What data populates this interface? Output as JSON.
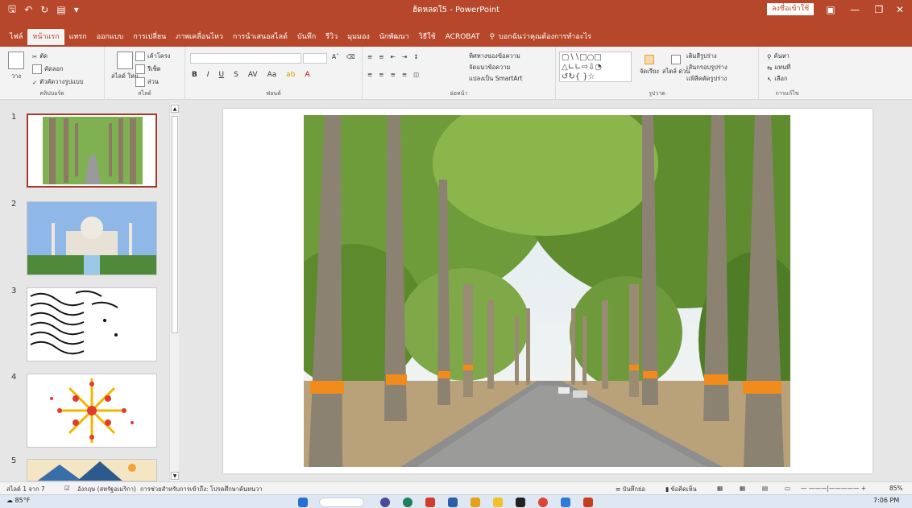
{
  "window": {
    "title": "ฮ้ดหลดใ5 - PowerPoint",
    "signin": "ลงชื่อเข้าใช้",
    "qat": [
      "save-icon",
      "undo-icon",
      "redo-icon",
      "present-icon",
      "customize-icon"
    ]
  },
  "tabs": [
    {
      "label": "ไฟล์"
    },
    {
      "label": "หน้าแรก",
      "active": true
    },
    {
      "label": "แทรก"
    },
    {
      "label": "ออกแบบ"
    },
    {
      "label": "การเปลี่ยน"
    },
    {
      "label": "ภาพเคลื่อนไหว"
    },
    {
      "label": "การนำเสนอสไลด์"
    },
    {
      "label": "บันทึก"
    },
    {
      "label": "รีวิว"
    },
    {
      "label": "มุมมอง"
    },
    {
      "label": "นักพัฒนา"
    },
    {
      "label": "วิธีใช้"
    },
    {
      "label": "ACROBAT"
    }
  ],
  "tellme": "บอกฉันว่าคุณต้องการทำอะไร",
  "ribbon": {
    "clipboard": {
      "paste": "วาง",
      "cut": "ตัด",
      "copy": "คัดลอก",
      "format_painter": "ตัวคัดวางรูปแบบ",
      "label": "คลิปบอร์ด"
    },
    "slides": {
      "new_slide": "สไลด์ ใหม่",
      "layout": "เค้าโครง",
      "reset": "รีเซ็ต",
      "section": "ส่วน",
      "label": "สไลด์"
    },
    "font": {
      "bold": "B",
      "italic": "I",
      "underline": "U",
      "strike": "S",
      "label": "ฟอนต์"
    },
    "paragraph": {
      "text_direction": "ทิศทางของข้อความ",
      "align_text": "จัดแนวข้อความ",
      "smartart": "แปลงเป็น SmartArt",
      "label": "ย่อหน้า"
    },
    "drawing": {
      "arrange": "จัดเรียง",
      "quick_styles": "สไตล์ ด่วน",
      "shape_fill": "เติมสีรูปร่าง",
      "shape_outline": "เส้นกรอบรูปร่าง",
      "shape_effects": "แฟ้ลีคตัดรูปร่าง",
      "label": "รูปวาด"
    },
    "editing": {
      "find": "ค้นหา",
      "replace": "แทนที่",
      "select": "เลือก",
      "label": "การแก้ไข"
    }
  },
  "thumbnails": [
    {
      "number": "1",
      "selected": true
    },
    {
      "number": "2"
    },
    {
      "number": "3"
    },
    {
      "number": "4"
    },
    {
      "number": "5"
    }
  ],
  "statusbar": {
    "slide_count": "สไลด์ 1 จาก 7",
    "language": "อังกฤษ (สหรัฐอเมริกา)",
    "accessibility": "การช่วยสำหรับการเข้าถึง: โปรดศึกษาค้นหนวา",
    "notes": "บันทึกย่อ",
    "comments": "ข้อคิดเห็น",
    "zoom": "85%"
  },
  "taskbar": {
    "weather": "85°F",
    "time": "7:06 PM"
  }
}
